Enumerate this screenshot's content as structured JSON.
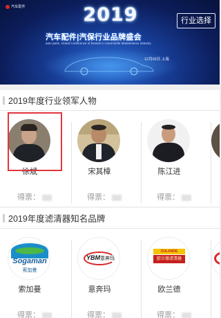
{
  "banner": {
    "logo_text": "汽车配件",
    "year": "2019",
    "title": "汽车配件|汽保行业品牌盛会",
    "subtitle": "auto parts, Grand Conference of Brands in Automobile Maintenance Industry",
    "date_location": "12月02日 上海",
    "industry_button": "行业选择"
  },
  "sections": [
    {
      "title": "2019年度行业领军人物",
      "vote_label": "得票：",
      "items": [
        {
          "name": "徐斌",
          "selected": true
        },
        {
          "name": "宋其樟",
          "selected": false
        },
        {
          "name": "陈江进",
          "selected": false
        },
        {
          "name": "",
          "selected": false
        }
      ]
    },
    {
      "title": "2019年度滤清器知名品牌",
      "vote_label": "得票：",
      "items": [
        {
          "name": "索加曼",
          "logo": "Sogaman",
          "logo_cn": "索加曼"
        },
        {
          "name": "意奔玛",
          "logo": "YBM",
          "logo_cn": "意奔玛"
        },
        {
          "name": "欧兰德",
          "logo": "OULANDE",
          "logo_cn": "欧兰德滤清器"
        },
        {
          "name": "",
          "logo": ""
        }
      ]
    }
  ],
  "colors": {
    "selected_border": "#e0363c",
    "banner_dark": "#0c1d5b",
    "accent_pink": "#e0348a"
  }
}
